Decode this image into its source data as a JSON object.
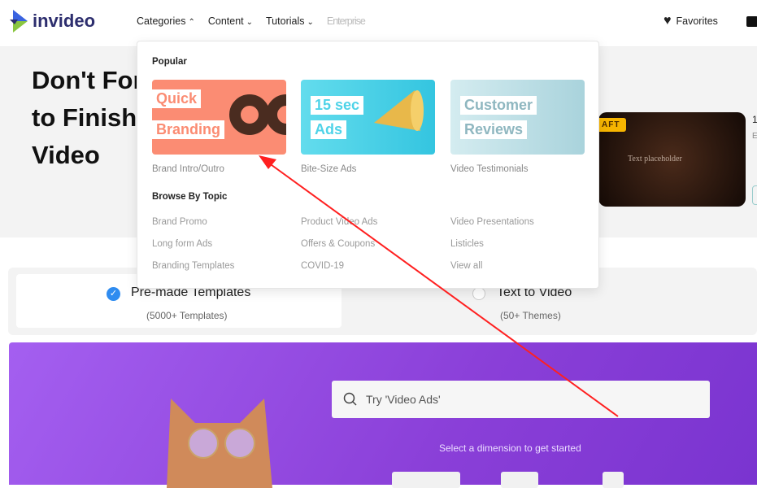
{
  "nav": {
    "brand": "invideo",
    "items": [
      {
        "label": "Categories",
        "chevron": "up"
      },
      {
        "label": "Content",
        "chevron": "down"
      },
      {
        "label": "Tutorials",
        "chevron": "down"
      },
      {
        "label": "Enterprise"
      }
    ],
    "favorites": "Favorites"
  },
  "hero": {
    "title_lines": [
      "Don't For",
      "to Finish",
      "Video"
    ],
    "thumb_badge": "AFT",
    "thumb_text": "Text placeholder",
    "side_title": "1",
    "side_sub": "E"
  },
  "dropdown": {
    "popular_heading": "Popular",
    "cards": [
      {
        "line1": "Quick",
        "line2": "Branding",
        "caption": "Brand Intro/Outro",
        "color": "#fb8c73"
      },
      {
        "line1": "15 sec",
        "line2": "Ads",
        "caption": "Bite-Size Ads",
        "color": "#4fd3e8"
      },
      {
        "line1": "Customer",
        "line2": "Reviews",
        "caption": "Video Testimonials",
        "color": "#c4e3ea"
      }
    ],
    "topic_heading": "Browse By Topic",
    "topics": [
      [
        "Brand Promo",
        "Long form Ads",
        "Branding Templates"
      ],
      [
        "Product Video Ads",
        "Offers & Coupons",
        "COVID-19"
      ],
      [
        "Video Presentations",
        "Listicles",
        "View all"
      ]
    ]
  },
  "modes": [
    {
      "title": "Pre-made Templates",
      "sub": "(5000+ Templates)",
      "selected": true
    },
    {
      "title": "Text to Video",
      "sub": "(50+ Themes)",
      "selected": false
    }
  ],
  "search": {
    "placeholder": "Try 'Video Ads'",
    "dimension_label": "Select a dimension to get started"
  },
  "colors": {
    "accent": "#2f8cf0",
    "banner": "#9b50e8",
    "annotation_arrow": "#ff2020"
  }
}
